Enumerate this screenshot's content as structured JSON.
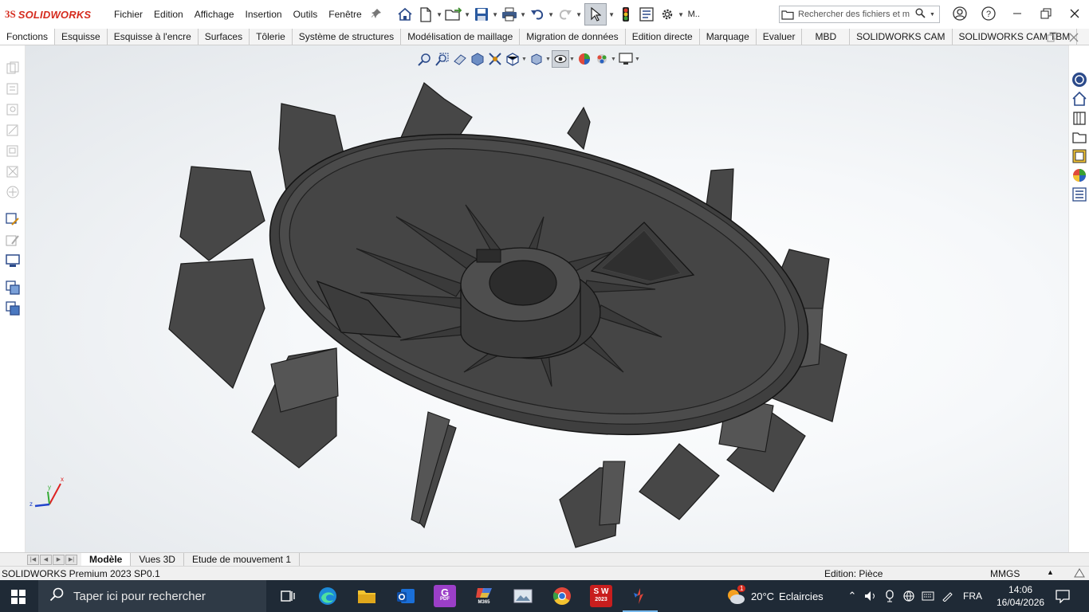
{
  "app": {
    "brand": "SOLIDWORKS",
    "brand_prefix": "3S"
  },
  "menu": [
    "Fichier",
    "Edition",
    "Affichage",
    "Insertion",
    "Outils",
    "Fenêtre"
  ],
  "toolbar": {
    "pin_icon": "pin-icon",
    "icons": [
      "home-icon",
      "new-document-icon",
      "open-icon",
      "save-icon",
      "print-icon",
      "undo-icon",
      "redo-icon",
      "select-icon",
      "rebuild-icon",
      "file-properties-icon",
      "options-icon"
    ],
    "more_label": "M.."
  },
  "search": {
    "placeholder": "Rechercher des fichiers et m"
  },
  "window_controls": [
    "user-icon",
    "help-icon",
    "minimize-icon",
    "restore-icon",
    "close-icon"
  ],
  "tabs": [
    "Fonctions",
    "Esquisse",
    "Esquisse à l'encre",
    "Surfaces",
    "Tôlerie",
    "Système de structures",
    "Modélisation de maillage",
    "Migration de données",
    "Edition directe",
    "Marquage",
    "Evaluer",
    "MBD",
    "SOLIDWORKS CAM",
    "SOLIDWORKS CAM TBM"
  ],
  "triad": {
    "x": "x",
    "y": "y",
    "z": "z"
  },
  "bottom_tabs": [
    "Modèle",
    "Vues 3D",
    "Etude de mouvement 1"
  ],
  "status": {
    "product": "SOLIDWORKS Premium 2023 SP0.1",
    "mode": "Edition: Pièce",
    "units": "MMGS",
    "units_arrow": "▲"
  },
  "taskbar": {
    "search_placeholder": "Taper ici pour rechercher",
    "apps": [
      "task-view-icon",
      "edge-icon",
      "file-explorer-icon",
      "outlook-icon",
      "pdf-app-icon",
      "m365-icon",
      "photos-icon",
      "chrome-icon",
      "solidworks-2023-icon",
      "solidworks-active-icon"
    ],
    "sw_badge": "S W",
    "sw_year": "2023",
    "m365_label": "M365",
    "pdf_label": "PDF",
    "weather": "20°C",
    "weather_desc": "Eclaircies",
    "weather_badge": "1",
    "lang": "FRA",
    "time": "14:06",
    "date": "16/04/2026"
  },
  "colors": {
    "brand_red": "#d52b1e",
    "model_gray": "#4a4a4a",
    "taskbar": "#1f2a36"
  }
}
